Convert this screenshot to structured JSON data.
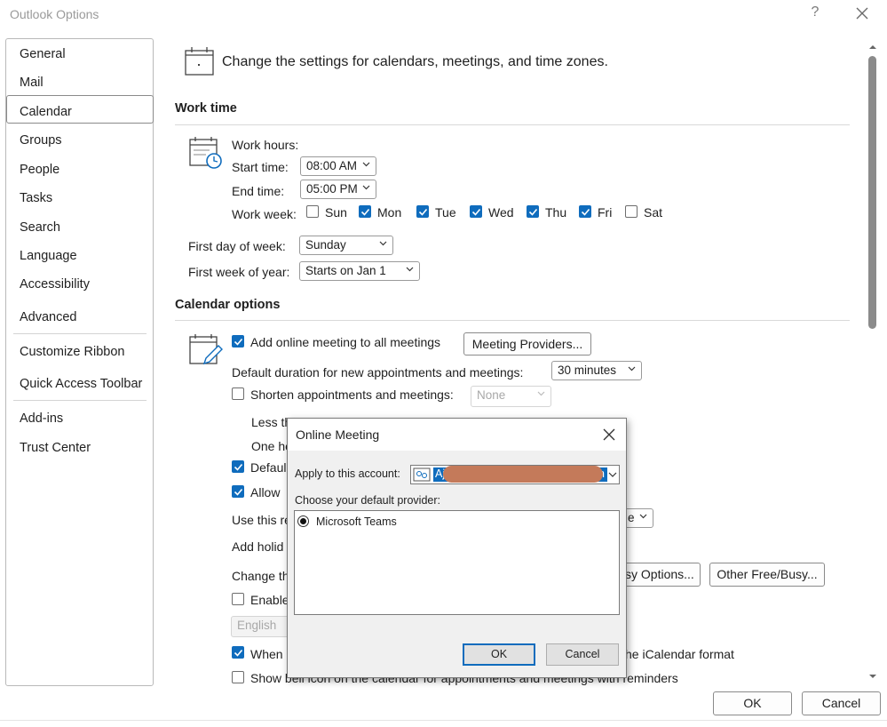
{
  "window": {
    "title": "Outlook Options",
    "help": "?"
  },
  "sidebar": {
    "items": [
      {
        "label": "General"
      },
      {
        "label": "Mail"
      },
      {
        "label": "Calendar"
      },
      {
        "label": "Groups"
      },
      {
        "label": "People"
      },
      {
        "label": "Tasks"
      },
      {
        "label": "Search"
      },
      {
        "label": "Language"
      },
      {
        "label": "Accessibility"
      },
      {
        "label": "Advanced"
      },
      {
        "label": "Customize Ribbon"
      },
      {
        "label": "Quick Access Toolbar"
      },
      {
        "label": "Add-ins"
      },
      {
        "label": "Trust Center"
      }
    ],
    "selected": "Calendar"
  },
  "header": {
    "text": "Change the settings for calendars, meetings, and time zones."
  },
  "work_time": {
    "heading": "Work time",
    "work_hours_label": "Work hours:",
    "start_label": "Start time:",
    "start_value": "08:00 AM",
    "end_label": "End time:",
    "end_value": "05:00 PM",
    "week_label": "Work week:",
    "days": [
      {
        "label": "Sun",
        "checked": false
      },
      {
        "label": "Mon",
        "checked": true
      },
      {
        "label": "Tue",
        "checked": true
      },
      {
        "label": "Wed",
        "checked": true
      },
      {
        "label": "Thu",
        "checked": true
      },
      {
        "label": "Fri",
        "checked": true
      },
      {
        "label": "Sat",
        "checked": false
      }
    ],
    "first_day_label": "First day of week:",
    "first_day_value": "Sunday",
    "first_week_label": "First week of year:",
    "first_week_value": "Starts on Jan 1"
  },
  "calendar_options": {
    "heading": "Calendar options",
    "add_online_label": "Add online meeting to all meetings",
    "meeting_providers_btn": "Meeting Providers...",
    "default_duration_label": "Default duration for new appointments and meetings:",
    "default_duration_value": "30 minutes",
    "shorten_label": "Shorten appointments and meetings:",
    "shorten_value": "None",
    "less_than": "Less th",
    "one_hour": "One ho",
    "default_partial": "Defaul",
    "allow_partial": "Allow",
    "use_this_partial": "Use this re",
    "use_this_suffix": "e",
    "add_holidays_partial": "Add holid",
    "change_partial": "Change th",
    "busy_options_btn": "sy Options...",
    "other_freebusy_btn": "Other Free/Busy...",
    "enable_partial": "Enable",
    "english_value": "English",
    "when_partial": "When",
    "icalendar_suffix": "he iCalendar format",
    "bell_label": "Show bell icon on the calendar for appointments and meetings with reminders"
  },
  "dialog": {
    "title": "Online Meeting",
    "apply_label": "Apply to this account:",
    "account_prefix": "Aj",
    "account_suffix": "n",
    "choose_label": "Choose your default provider:",
    "providers": [
      {
        "label": "Microsoft Teams",
        "selected": true
      }
    ],
    "ok": "OK",
    "cancel": "Cancel"
  },
  "footer": {
    "ok": "OK",
    "cancel": "Cancel"
  }
}
